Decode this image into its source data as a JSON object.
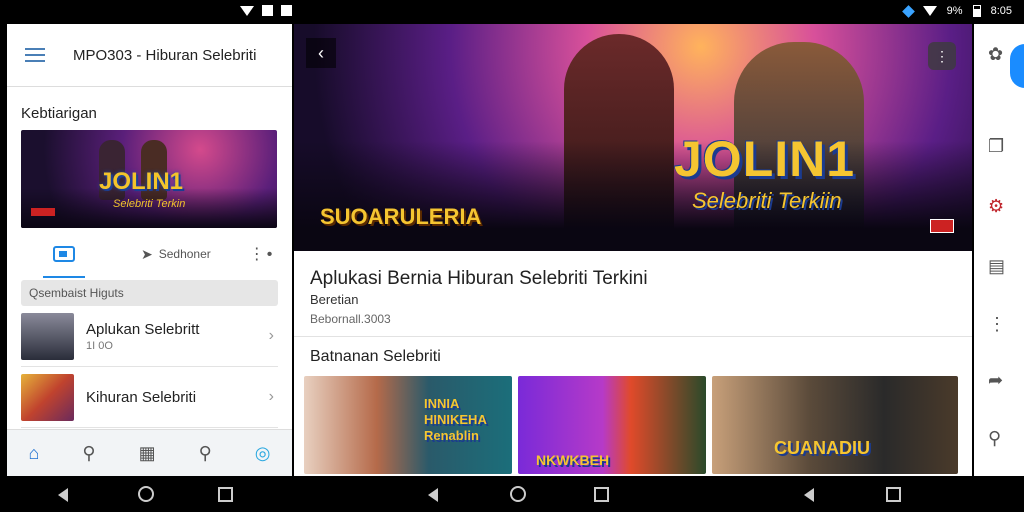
{
  "status_bar": {
    "battery": "9%",
    "time": "8:05"
  },
  "left_panel": {
    "app_title": "MPO303 - Hiburan Selebriti",
    "section_title": "Kebtiarigan",
    "banner": {
      "logo_text": "JOLIN1",
      "subtitle": "Selebriti Terkin"
    },
    "tabs": {
      "tab2_label": "Sedhoner",
      "tab3_label": "⋮•"
    },
    "search_placeholder": "Qsembaist Higuts",
    "list": [
      {
        "title": "Aplukan Selebritt",
        "sub": "1I 0O"
      },
      {
        "title": "Kihuran Selebriti",
        "sub": ""
      }
    ]
  },
  "center_panel": {
    "hero": {
      "title": "JOLIN1",
      "subtitle": "Selebriti Terkiin",
      "left_text": "SUOARULERIA"
    },
    "article_title": "Aplukasi Bernia Hiburan Selebriti Terkini",
    "article_category": "Beretian",
    "article_source": "Bebornall.3003",
    "section_title": "Batnanan Selebriti",
    "cards": [
      {
        "text": "INNIA HINIKEHA Renablin"
      },
      {
        "text": "NKWKBEH"
      },
      {
        "text": "CUANADIU"
      }
    ]
  },
  "colors": {
    "accent": "#1e88e5",
    "logo_gold": "#f5c531",
    "fab": "#1a8cff"
  },
  "icons": {
    "left_bottom_nav": [
      "home-icon",
      "search-icon",
      "news-icon",
      "search-icon",
      "compass-icon"
    ],
    "right_rail": [
      "settings-icon",
      "copy-icon",
      "gear-icon",
      "document-icon",
      "more-vertical-icon",
      "share-icon",
      "search-icon"
    ]
  }
}
